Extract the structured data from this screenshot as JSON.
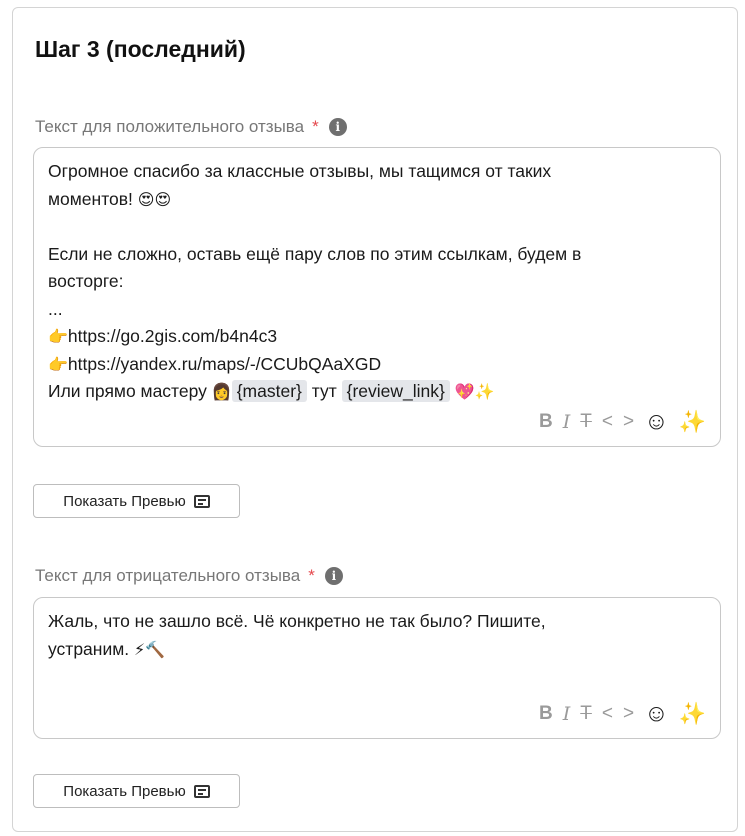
{
  "step": {
    "title": "Шаг 3 (последний)"
  },
  "positive": {
    "label": "Текст для положительного отзыва",
    "required_mark": "*",
    "info_glyph": "i",
    "lines": [
      {
        "text": "Огромное спасибо за классные отзывы, мы тащимся от таких"
      },
      {
        "text": "моментов!",
        "emoji": "😍😍"
      },
      {
        "text": ""
      },
      {
        "text": "Если не сложно, оставь ещё пару слов по этим ссылкам, будем в"
      },
      {
        "text": "восторге:"
      },
      {
        "text": "..."
      },
      {
        "emoji": "👉",
        "text": "https://go.2gis.com/b4n4c3"
      },
      {
        "emoji": "👉",
        "text": "https://yandex.ru/maps/-/CCUbQAaXGD"
      }
    ],
    "last_line": {
      "prefix": "Или прямо мастеру",
      "emoji_1": "👩",
      "tag_master": "{master}",
      "middle": "тут",
      "tag_review": "{review_link}",
      "emoji_2": "💖✨"
    },
    "preview_button": "Показать Превью"
  },
  "negative": {
    "label": "Текст для отрицательного отзыва",
    "required_mark": "*",
    "info_glyph": "i",
    "lines": [
      {
        "text": "Жаль, что не зашло всё. Чё конкретно не так было? Пишите,"
      },
      {
        "text": "устраним.",
        "emoji": "⚡🔨"
      }
    ],
    "preview_button": "Показать Превью"
  },
  "toolbar": {
    "bold": "B",
    "italic": "I",
    "strike": "T",
    "code_left": "<",
    "code_right": ">",
    "emoji": "☺",
    "ai": "✨"
  },
  "icons": {
    "info": "info-icon",
    "emoji_picker": "smiley-icon",
    "ai_sparkles": "sparkles-icon",
    "preview": "document-icon"
  },
  "colors": {
    "required": "#e5484d",
    "label": "#777777",
    "ai_sparkles": "#c11dd8",
    "tag_bg": "#e4e6ea"
  }
}
